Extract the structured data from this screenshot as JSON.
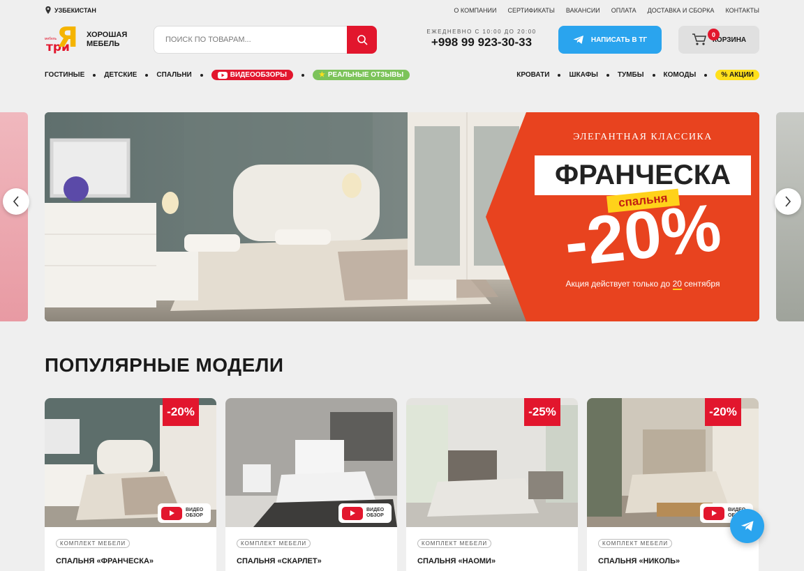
{
  "region": "УЗБЕКИСТАН",
  "top_nav": [
    "О КОМПАНИИ",
    "СЕРТИФИКАТЫ",
    "ВАКАНСИИ",
    "ОПЛАТА",
    "ДОСТАВКА И СБОРКА",
    "КОНТАКТЫ"
  ],
  "logo": {
    "small": "мебель",
    "tri": "три",
    "ya": "Я",
    "line1": "ХОРОШАЯ",
    "line2": "МЕБЕЛЬ"
  },
  "search": {
    "placeholder": "ПОИСК ПО ТОВАРАМ..."
  },
  "contact": {
    "hours": "ЕЖЕДНЕВНО С 10:00 ДО 20:00",
    "phone": "+998 99 923-30-33"
  },
  "telegram_button": "НАПИСАТЬ В ТГ",
  "cart": {
    "label": "КОРЗИНА",
    "count": "0"
  },
  "cat_nav_left": {
    "items": [
      "ГОСТИНЫЕ",
      "ДЕТСКИЕ",
      "СПАЛЬНИ"
    ],
    "video": "ВИДЕООБЗОРЫ",
    "reviews": "РЕАЛЬНЫЕ ОТЗЫВЫ"
  },
  "cat_nav_right": {
    "items": [
      "КРОВАТИ",
      "ШКАФЫ",
      "ТУМБЫ",
      "КОМОДЫ"
    ],
    "sale": "% АКЦИИ"
  },
  "banner": {
    "kicker": "ЭЛЕГАНТНАЯ КЛАССИКА",
    "title": "ФРАНЧЕСКА",
    "subtitle": "спальня",
    "discount": "-20%",
    "note_prefix": "Акция действует только до ",
    "note_day": "20",
    "note_suffix": " сентября",
    "accent_color": "#e8431f",
    "yellow_color": "#ffd21a"
  },
  "section_title": "ПОПУЛЯРНЫЕ МОДЕЛИ",
  "products": [
    {
      "tag": "КОМПЛЕКТ МЕБЕЛИ",
      "name": "СПАЛЬНЯ «ФРАНЧЕСКА»",
      "discount": "-20%",
      "video": true,
      "video_l1": "ВИДЕО",
      "video_l2": "ОБЗОР"
    },
    {
      "tag": "КОМПЛЕКТ МЕБЕЛИ",
      "name": "СПАЛЬНЯ «СКАРЛЕТ»",
      "discount": "",
      "video": true,
      "video_l1": "ВИДЕО",
      "video_l2": "ОБЗОР"
    },
    {
      "tag": "КОМПЛЕКТ МЕБЕЛИ",
      "name": "СПАЛЬНЯ «НАОМИ»",
      "discount": "-25%",
      "video": false,
      "video_l1": "",
      "video_l2": ""
    },
    {
      "tag": "КОМПЛЕКТ МЕБЕЛИ",
      "name": "СПАЛЬНЯ «НИКОЛЬ»",
      "discount": "-20%",
      "video": true,
      "video_l1": "ВИДЕО",
      "video_l2": "ОБЗОР"
    }
  ],
  "colors": {
    "brand_red": "#e2162d",
    "telegram_blue": "#2aa4ee",
    "sale_yellow": "#ffe01b",
    "reviews_green": "#7cc35a"
  }
}
